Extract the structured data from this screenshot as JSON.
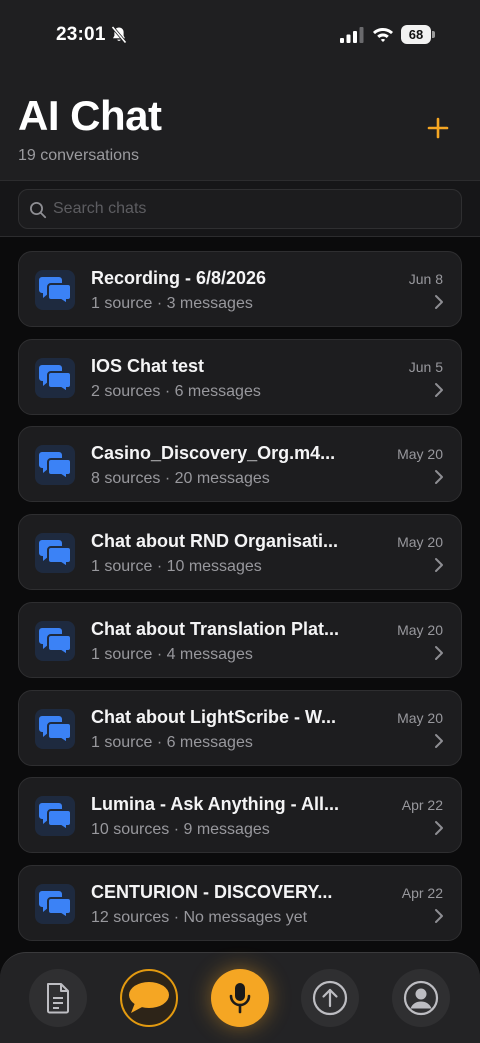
{
  "status_bar": {
    "time": "23:01",
    "battery": "68"
  },
  "header": {
    "title": "AI Chat",
    "subtitle": "19 conversations",
    "add_icon": "plus-icon"
  },
  "search": {
    "placeholder": "Search chats",
    "value": ""
  },
  "chats": [
    {
      "title": "Recording - 6/8/2026",
      "subtitle": "1 source · 3 messages",
      "date": "Jun 8"
    },
    {
      "title": "IOS Chat test",
      "subtitle": "2 sources · 6 messages",
      "date": "Jun 5"
    },
    {
      "title": "Casino_Discovery_Org.m4...",
      "subtitle": "8 sources · 20 messages",
      "date": "May 20"
    },
    {
      "title": "Chat about RND Organisati...",
      "subtitle": "1 source · 10 messages",
      "date": "May 20"
    },
    {
      "title": "Chat about Translation Plat...",
      "subtitle": "1 source · 4 messages",
      "date": "May 20"
    },
    {
      "title": "Chat about LightScribe - W...",
      "subtitle": "1 source · 6 messages",
      "date": "May 20"
    },
    {
      "title": "Lumina - Ask Anything - All...",
      "subtitle": "10 sources · 9 messages",
      "date": "Apr 22"
    },
    {
      "title": "CENTURION - DISCOVERY...",
      "subtitle": "12 sources · No messages yet",
      "date": "Apr 22"
    }
  ],
  "tab_bar": {
    "tabs": [
      {
        "icon": "document-icon",
        "active": false
      },
      {
        "icon": "chat-bubble-icon",
        "active": true
      },
      {
        "icon": "microphone-icon",
        "active": false
      },
      {
        "icon": "upload-icon",
        "active": false
      },
      {
        "icon": "profile-icon",
        "active": false
      }
    ]
  },
  "colors": {
    "accent": "#f5a623",
    "chat_icon": "#3b82f6",
    "background": "#0b0b0c",
    "card": "#1d1d1f"
  }
}
